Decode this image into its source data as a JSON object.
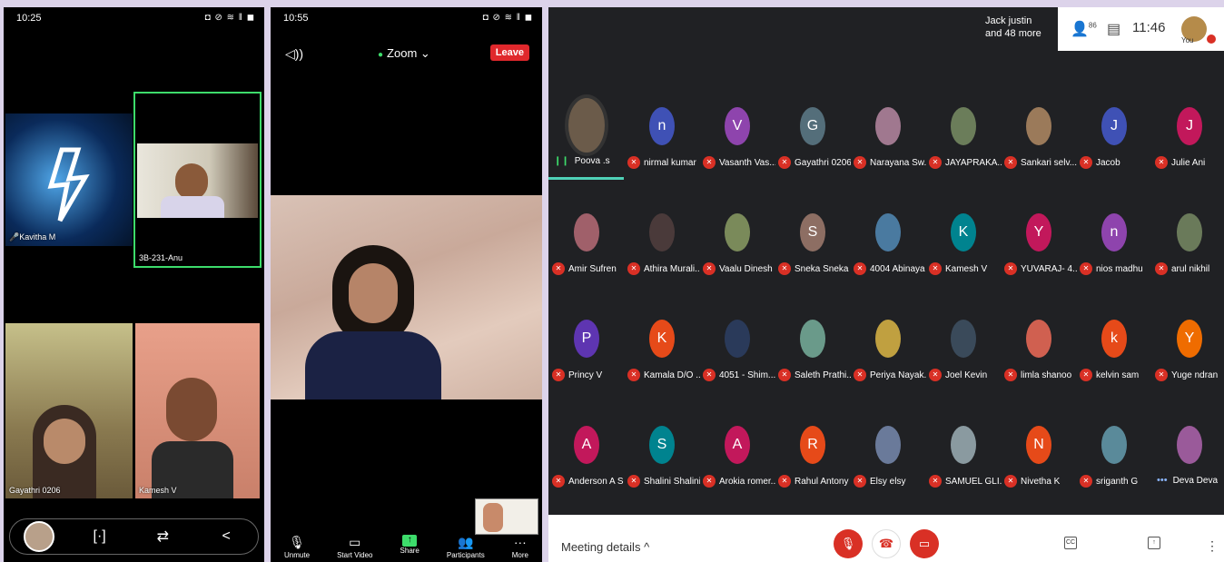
{
  "phone1": {
    "time": "10:25",
    "status_icons": "◘ ⊘ ≋ ‖ ◼",
    "tiles": [
      {
        "label": "Kavitha M",
        "muted": true
      },
      {
        "label": "3B-231-Anu",
        "active": true
      },
      {
        "label": "Gayathri 0206"
      },
      {
        "label": "Kamesh V"
      }
    ],
    "toolbar": [
      "avatar-thumbnail",
      "focus-icon",
      "switch-camera-icon",
      "share-icon"
    ]
  },
  "phone2": {
    "time": "10:55",
    "status_icons": "◘ ⊘ ≋ ‖ ◼",
    "title": "Zoom",
    "leave": "Leave",
    "toolbar": [
      {
        "label": "Unmute",
        "icon": "mic-off-icon"
      },
      {
        "label": "Start Video",
        "icon": "video-off-icon"
      },
      {
        "label": "Share",
        "icon": "share-screen-icon"
      },
      {
        "label": "Participants",
        "icon": "participants-icon"
      },
      {
        "label": "More",
        "icon": "more-icon"
      }
    ]
  },
  "meet": {
    "header": {
      "presenter_line1": "Jack justin",
      "presenter_line2": "and 48 more",
      "participants_count": "86",
      "time": "11:46",
      "you_label": "You"
    },
    "participants": [
      {
        "name": "Poova .s",
        "initial": "",
        "color": "#6b5b4a",
        "speaking": true
      },
      {
        "name": "nirmal kumar",
        "initial": "n",
        "color": "#3f51b5"
      },
      {
        "name": "Vasanth Vas...",
        "initial": "V",
        "color": "#8e44ad"
      },
      {
        "name": "Gayathri 0206",
        "initial": "G",
        "color": "#546e7a"
      },
      {
        "name": "Narayana Sw...",
        "initial": "",
        "color": "#a0788f"
      },
      {
        "name": "JAYAPRAKA...",
        "initial": "",
        "color": "#6b7d5a"
      },
      {
        "name": "Sankari selv...",
        "initial": "",
        "color": "#9b7a5a"
      },
      {
        "name": "Jacob",
        "initial": "J",
        "color": "#3f51b5"
      },
      {
        "name": "Julie Ani",
        "initial": "J",
        "color": "#c2185b"
      },
      {
        "name": "Amir Sufren",
        "initial": "",
        "color": "#a0606a"
      },
      {
        "name": "Athira Murali...",
        "initial": "",
        "color": "#4a3a3a"
      },
      {
        "name": "Vaalu Dinesh",
        "initial": "",
        "color": "#7a8a5a"
      },
      {
        "name": "Sneka Sneka",
        "initial": "S",
        "color": "#8d6e63"
      },
      {
        "name": "4004 Abinaya",
        "initial": "",
        "color": "#4a7aa0"
      },
      {
        "name": "Kamesh V",
        "initial": "K",
        "color": "#00838f"
      },
      {
        "name": "YUVARAJ- 4...",
        "initial": "Y",
        "color": "#c2185b"
      },
      {
        "name": "nios madhu",
        "initial": "n",
        "color": "#8e44ad"
      },
      {
        "name": "arul nikhil",
        "initial": "",
        "color": "#6a7a5a"
      },
      {
        "name": "Princy V",
        "initial": "P",
        "color": "#5e35b1"
      },
      {
        "name": "Kamala D/O ...",
        "initial": "K",
        "color": "#e64a19"
      },
      {
        "name": "4051 - Shim...",
        "initial": "",
        "color": "#2a3a5a"
      },
      {
        "name": "Saleth Prathi...",
        "initial": "",
        "color": "#6a9a8a"
      },
      {
        "name": "Periya Nayak...",
        "initial": "",
        "color": "#c0a040"
      },
      {
        "name": "Joel Kevin",
        "initial": "",
        "color": "#3a4a5a"
      },
      {
        "name": "limla shanoo",
        "initial": "",
        "color": "#d06050"
      },
      {
        "name": "kelvin sam",
        "initial": "k",
        "color": "#e64a19"
      },
      {
        "name": "Yuge ndran",
        "initial": "Y",
        "color": "#ef6c00"
      },
      {
        "name": "Anderson A S",
        "initial": "A",
        "color": "#c2185b"
      },
      {
        "name": "Shalini Shalini",
        "initial": "S",
        "color": "#00838f"
      },
      {
        "name": "Arokia romer...",
        "initial": "A",
        "color": "#c2185b"
      },
      {
        "name": "Rahul Antony",
        "initial": "R",
        "color": "#e64a19"
      },
      {
        "name": "Elsy elsy",
        "initial": "",
        "color": "#6a7a9a"
      },
      {
        "name": "SAMUEL GLI...",
        "initial": "",
        "color": "#8a9aa0"
      },
      {
        "name": "Nivetha K",
        "initial": "N",
        "color": "#e64a19"
      },
      {
        "name": "sriganth G",
        "initial": "",
        "color": "#5a8a9a"
      },
      {
        "name": "Deva Deva",
        "initial": "",
        "color": "#9a5a9a",
        "more": true
      }
    ],
    "footer": {
      "details": "Meeting details",
      "cc": "CC"
    }
  }
}
